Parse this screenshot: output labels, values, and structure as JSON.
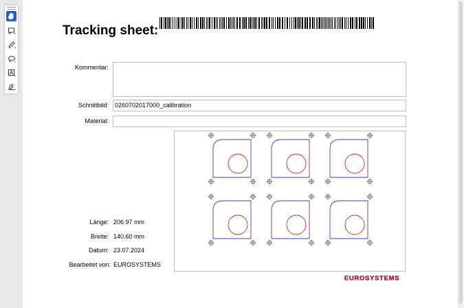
{
  "viewer": {
    "tools": [
      {
        "name": "hand-tool",
        "active": true
      },
      {
        "name": "add-comment-tool",
        "active": false
      },
      {
        "name": "pen-tool",
        "active": false
      },
      {
        "name": "lasso-tool",
        "active": false
      },
      {
        "name": "text-box-tool",
        "active": false
      },
      {
        "name": "fill-sign-tool",
        "active": false
      }
    ],
    "accent": "#1d5fd6"
  },
  "sheet": {
    "title": "Tracking sheet:",
    "fields": {
      "kommentar_label": "Kommentar:",
      "kommentar_value": "",
      "schnittbild_label": "Schnittbild:",
      "schnittbild_value": "0260702017000_calibration",
      "material_label": "Material:",
      "material_value": ""
    },
    "info": {
      "laenge_label": "Länge:",
      "laenge_value": "206.97 mm",
      "breite_label": "Breite:",
      "breite_value": "140.60 mm",
      "datum_label": "Datum:",
      "datum_value": "23.07.2024",
      "bearbeitet_label": "Bearbeitet von:",
      "bearbeitet_value": "EUROSYSTEMS"
    },
    "drawing": {
      "rows": 2,
      "cols": 3,
      "outline_color": "#3a3ad6",
      "hole_color": "#e02020",
      "marker_color": "#555555"
    },
    "logo": {
      "text": "EUROSYSTEMS",
      "color": "#c8102e"
    }
  }
}
